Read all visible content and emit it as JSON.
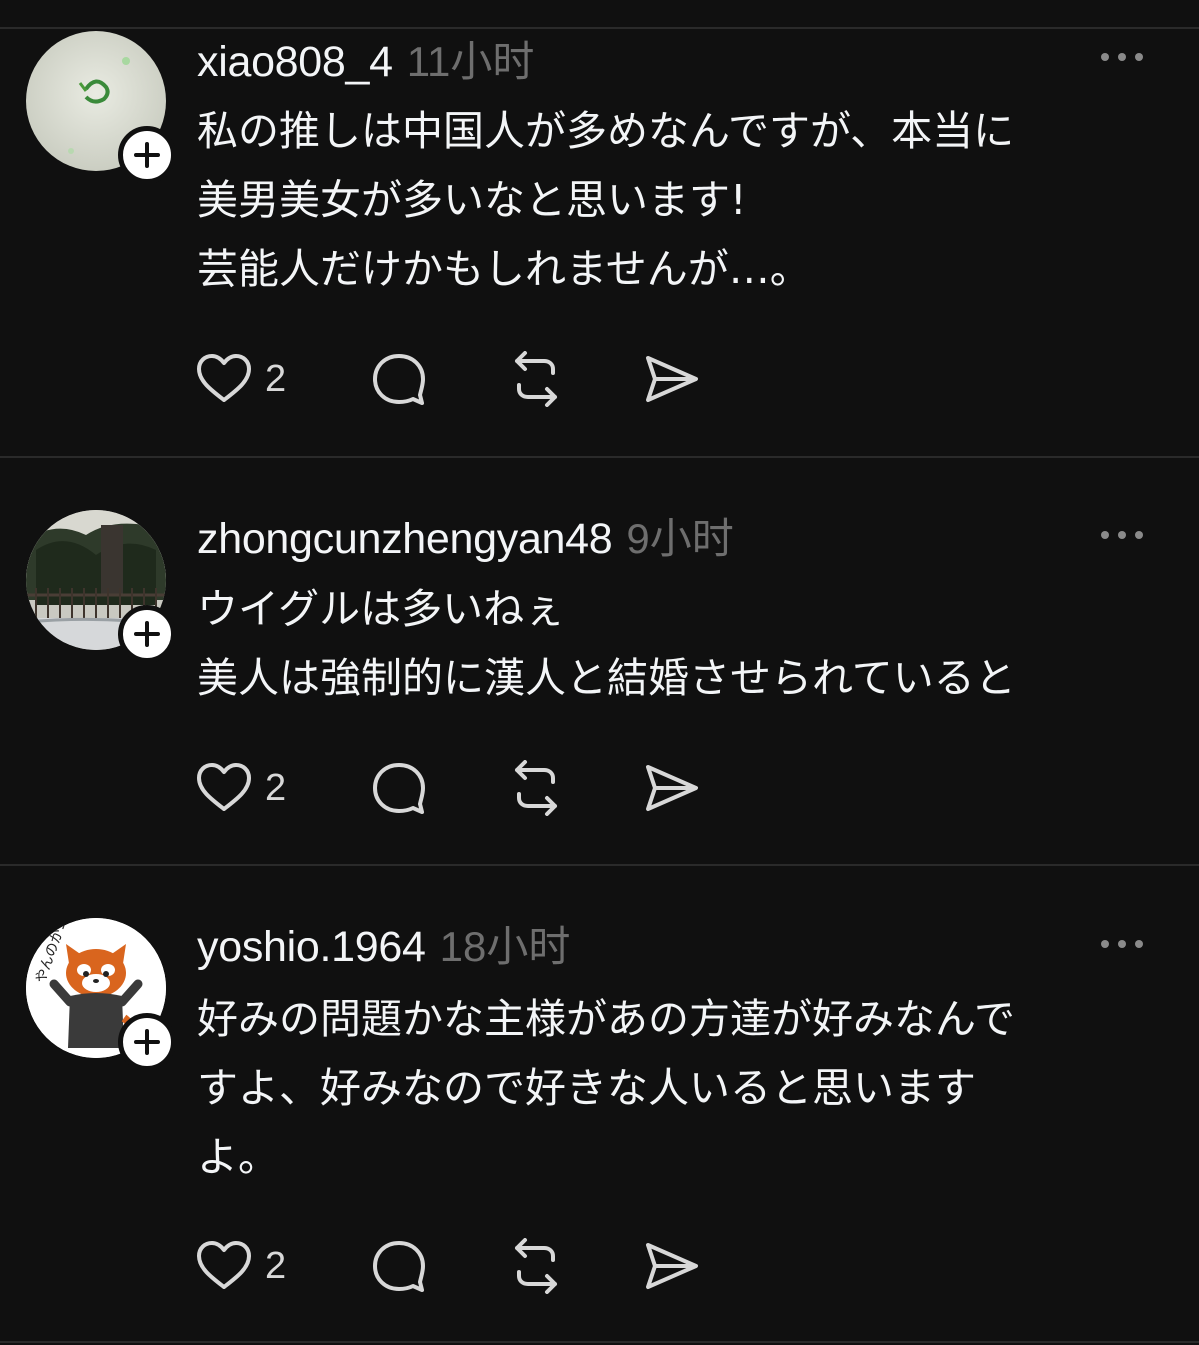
{
  "posts": [
    {
      "username": "xiao808_4",
      "timestamp": "11小时",
      "lines": [
        "私の推しは中国人が多めなんですが、本当に",
        "美男美女が多いなと思います!",
        "芸能人だけかもしれませんが…。"
      ],
      "likes": "2"
    },
    {
      "username": "zhongcunzhengyan48",
      "timestamp": "9小时",
      "lines": [
        "ウイグルは多いねぇ",
        "美人は強制的に漢人と結婚させられていると"
      ],
      "likes": "2"
    },
    {
      "username": "yoshio.1964",
      "timestamp": "18小时",
      "lines": [
        "好みの問題かな主様があの方達が好みなんで",
        "すよ、好みなので好きな人いると思います",
        "よ。"
      ],
      "likes": "2"
    }
  ],
  "avatar_text": "やんのかコラ。",
  "icons": [
    "heart-icon",
    "comment-icon",
    "repost-icon",
    "share-icon",
    "more-icon",
    "plus-icon"
  ],
  "colors": {
    "background": "#101010",
    "text": "#f3f5f7",
    "secondary": "#6e6e6e",
    "divider": "#2a2a2a",
    "badge": "#ffffff"
  }
}
